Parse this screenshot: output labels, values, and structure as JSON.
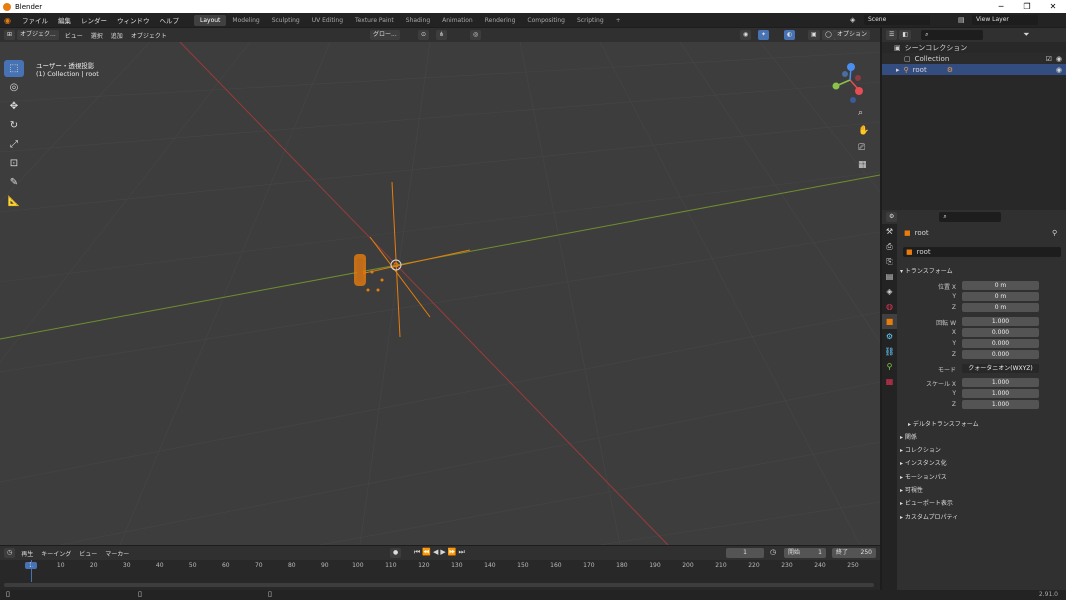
{
  "titlebar": {
    "title": "Blender",
    "minimize": "─",
    "restore": "❐",
    "close": "✕"
  },
  "menu": [
    "ファイル",
    "編集",
    "レンダー",
    "ウィンドウ",
    "ヘルプ"
  ],
  "workspaces": [
    "Layout",
    "Modeling",
    "Sculpting",
    "UV Editing",
    "Texture Paint",
    "Shading",
    "Animation",
    "Rendering",
    "Compositing",
    "Scripting",
    "+"
  ],
  "scene": {
    "name": "Scene",
    "view_layer": "View Layer"
  },
  "viewport_header": {
    "mode": "オブジェク...",
    "menus": [
      "ビュー",
      "選択",
      "追加",
      "オブジェクト"
    ],
    "orientation": "グロー...",
    "options": "オプション"
  },
  "viewport": {
    "view_name": "ユーザー・透視投影",
    "collection_info": "(1) Collection | root"
  },
  "outliner": {
    "search_placeholder": "",
    "scene_collection": "シーンコレクション",
    "collection": "Collection",
    "object": "root"
  },
  "properties": {
    "object_name": "root",
    "data_name": "root",
    "transform_header": "トランスフォーム",
    "location_label": "位置 X",
    "rotation_label": "回転 W",
    "scale_label": "スケール X",
    "mode_label": "モード",
    "mode_value": "クォータニオン(WXYZ)",
    "location": [
      "0 m",
      "0 m",
      "0 m"
    ],
    "rotation": [
      "1.000",
      "0.000",
      "0.000",
      "0.000"
    ],
    "scale": [
      "1.000",
      "1.000",
      "1.000"
    ],
    "axis_y": "Y",
    "axis_z": "Z",
    "axis_x": "X",
    "delta": "デルタトランスフォーム",
    "sections": [
      "関係",
      "コレクション",
      "インスタンス化",
      "モーションパス",
      "可視性",
      "ビューポート表示",
      "カスタムプロパティ"
    ]
  },
  "timeline": {
    "menus": [
      "再生",
      "キーイング",
      "ビュー",
      "マーカー"
    ],
    "current_frame": "1",
    "start_label": "開始",
    "start": "1",
    "end_label": "終了",
    "end": "250",
    "ticks": [
      "1",
      "10",
      "20",
      "30",
      "40",
      "50",
      "60",
      "70",
      "80",
      "90",
      "100",
      "110",
      "120",
      "130",
      "140",
      "150",
      "160",
      "170",
      "180",
      "190",
      "200",
      "210",
      "220",
      "230",
      "240",
      "250"
    ]
  },
  "status": {
    "version": "2.91.0"
  },
  "colors": {
    "accent": "#4772b3",
    "orange": "#e87d0d",
    "x_axis": "#9a3b3b",
    "y_axis": "#6f8f2e"
  }
}
